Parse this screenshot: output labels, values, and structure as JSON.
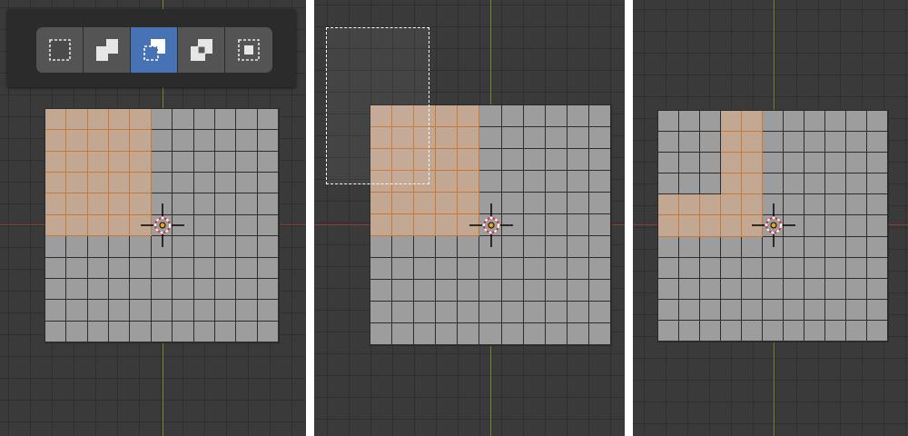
{
  "window": {
    "title": ""
  },
  "toolbar": {
    "modes": [
      {
        "name": "set",
        "icon": "select-set-icon",
        "active": false
      },
      {
        "name": "extend",
        "icon": "select-extend-icon",
        "active": false
      },
      {
        "name": "subtract",
        "icon": "select-subtract-icon",
        "active": true
      },
      {
        "name": "invert",
        "icon": "select-invert-icon",
        "active": false
      },
      {
        "name": "intersect",
        "icon": "select-intersect-icon",
        "active": false
      }
    ]
  },
  "meshes": [
    {
      "panel": "before",
      "cols": 11,
      "rows": 11,
      "selected_faces": [
        [
          0,
          0
        ],
        [
          0,
          1
        ],
        [
          0,
          2
        ],
        [
          0,
          3
        ],
        [
          0,
          4
        ],
        [
          1,
          0
        ],
        [
          1,
          1
        ],
        [
          1,
          2
        ],
        [
          1,
          3
        ],
        [
          1,
          4
        ],
        [
          2,
          0
        ],
        [
          2,
          1
        ],
        [
          2,
          2
        ],
        [
          2,
          3
        ],
        [
          2,
          4
        ],
        [
          3,
          0
        ],
        [
          3,
          1
        ],
        [
          3,
          2
        ],
        [
          3,
          3
        ],
        [
          3,
          4
        ],
        [
          4,
          0
        ],
        [
          4,
          1
        ],
        [
          4,
          2
        ],
        [
          4,
          3
        ],
        [
          4,
          4
        ],
        [
          5,
          0
        ],
        [
          5,
          1
        ],
        [
          5,
          2
        ],
        [
          5,
          3
        ],
        [
          5,
          4
        ]
      ]
    },
    {
      "panel": "box-select",
      "cols": 11,
      "rows": 11,
      "selected_faces": [
        [
          0,
          0
        ],
        [
          0,
          1
        ],
        [
          0,
          2
        ],
        [
          0,
          3
        ],
        [
          0,
          4
        ],
        [
          1,
          0
        ],
        [
          1,
          1
        ],
        [
          1,
          2
        ],
        [
          1,
          3
        ],
        [
          1,
          4
        ],
        [
          2,
          0
        ],
        [
          2,
          1
        ],
        [
          2,
          2
        ],
        [
          2,
          3
        ],
        [
          2,
          4
        ],
        [
          3,
          0
        ],
        [
          3,
          1
        ],
        [
          3,
          2
        ],
        [
          3,
          3
        ],
        [
          3,
          4
        ],
        [
          4,
          0
        ],
        [
          4,
          1
        ],
        [
          4,
          2
        ],
        [
          4,
          3
        ],
        [
          4,
          4
        ],
        [
          5,
          0
        ],
        [
          5,
          1
        ],
        [
          5,
          2
        ],
        [
          5,
          3
        ],
        [
          5,
          4
        ]
      ]
    },
    {
      "panel": "after",
      "cols": 11,
      "rows": 11,
      "selected_faces": [
        [
          0,
          3
        ],
        [
          0,
          4
        ],
        [
          1,
          3
        ],
        [
          1,
          4
        ],
        [
          2,
          3
        ],
        [
          2,
          4
        ],
        [
          3,
          3
        ],
        [
          3,
          4
        ],
        [
          4,
          0
        ],
        [
          4,
          1
        ],
        [
          4,
          2
        ],
        [
          4,
          3
        ],
        [
          4,
          4
        ],
        [
          5,
          0
        ],
        [
          5,
          1
        ],
        [
          5,
          2
        ],
        [
          5,
          3
        ],
        [
          5,
          4
        ]
      ]
    }
  ],
  "colors": {
    "selection": "#c2a792",
    "selection_edge": "#c67a35",
    "active_mode": "#4772b3",
    "mesh_face": "#9d9d9d",
    "viewport_bg": "#3a3a3a"
  }
}
